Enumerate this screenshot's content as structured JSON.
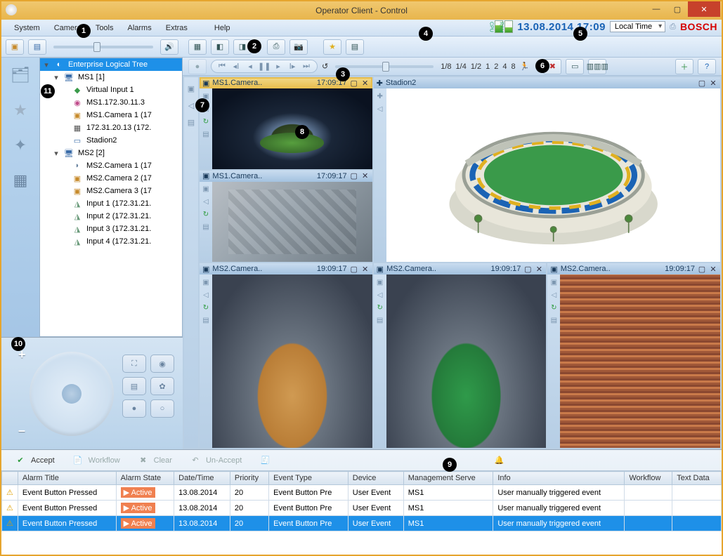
{
  "window": {
    "title": "Operator Client - Control"
  },
  "menu": {
    "system": "System",
    "camera": "Camera",
    "tools": "Tools",
    "alarms": "Alarms",
    "extras": "Extras",
    "help": "Help"
  },
  "header": {
    "datetime": "13.08.2014 17:09",
    "tz": "Local Time",
    "brand": "BOSCH",
    "cpu": "CPU",
    "ram": "RAM"
  },
  "tree": {
    "root": "Enterprise Logical Tree",
    "ms1": {
      "name": "MS1 [1]",
      "items": [
        "Virtual Input 1",
        "MS1.172.30.11.3",
        "MS1.Camera 1 (17",
        "172.31.20.13 (172.",
        "Stadion2"
      ]
    },
    "ms2": {
      "name": "MS2 [2]",
      "items": [
        "MS2.Camera 1 (17",
        "MS2.Camera 2 (17",
        "MS2.Camera 3 (17",
        "Input 1 (172.31.21.",
        "Input 2 (172.31.21.",
        "Input 3 (172.31.21.",
        "Input 4 (172.31.21."
      ]
    }
  },
  "speed": {
    "marks": [
      "1/8",
      "1/4",
      "1/2",
      "1",
      "2",
      "4",
      "8"
    ]
  },
  "panes": {
    "p1": {
      "title": "MS1.Camera..",
      "time": "17:09:17"
    },
    "p2": {
      "title": "Stadion2"
    },
    "p3": {
      "title": "MS1.Camera..",
      "time": "17:09:17"
    },
    "p4": {
      "title": "MS2.Camera..",
      "time": "19:09:17"
    },
    "p5": {
      "title": "MS2.Camera..",
      "time": "19:09:17"
    },
    "p6": {
      "title": "MS2.Camera..",
      "time": "19:09:17"
    }
  },
  "alarm": {
    "accept": "Accept",
    "workflow": "Workflow",
    "clear": "Clear",
    "unaccept": "Un-Accept",
    "cols": {
      "title": "Alarm Title",
      "state": "Alarm State",
      "dt": "Date/Time",
      "prio": "Priority",
      "et": "Event Type",
      "dev": "Device",
      "ms": "Management Serve",
      "info": "Info",
      "wf": "Workflow",
      "td": "Text Data"
    },
    "rows": [
      {
        "title": "Event Button Pressed",
        "state": "Active",
        "dt": "13.08.2014",
        "prio": "20",
        "et": "Event Button Pre",
        "dev": "User Event",
        "ms": "MS1",
        "info": "User manually triggered event"
      },
      {
        "title": "Event Button Pressed",
        "state": "Active",
        "dt": "13.08.2014",
        "prio": "20",
        "et": "Event Button Pre",
        "dev": "User Event",
        "ms": "MS1",
        "info": "User manually triggered event"
      },
      {
        "title": "Event Button Pressed",
        "state": "Active",
        "dt": "13.08.2014",
        "prio": "20",
        "et": "Event Button Pre",
        "dev": "User Event",
        "ms": "MS1",
        "info": "User manually triggered event"
      }
    ]
  },
  "callouts": {
    "c1": "1",
    "c2": "2",
    "c3": "3",
    "c4": "4",
    "c5": "5",
    "c6": "6",
    "c7": "7",
    "c8": "8",
    "c9": "9",
    "c10": "10",
    "c11": "11"
  }
}
